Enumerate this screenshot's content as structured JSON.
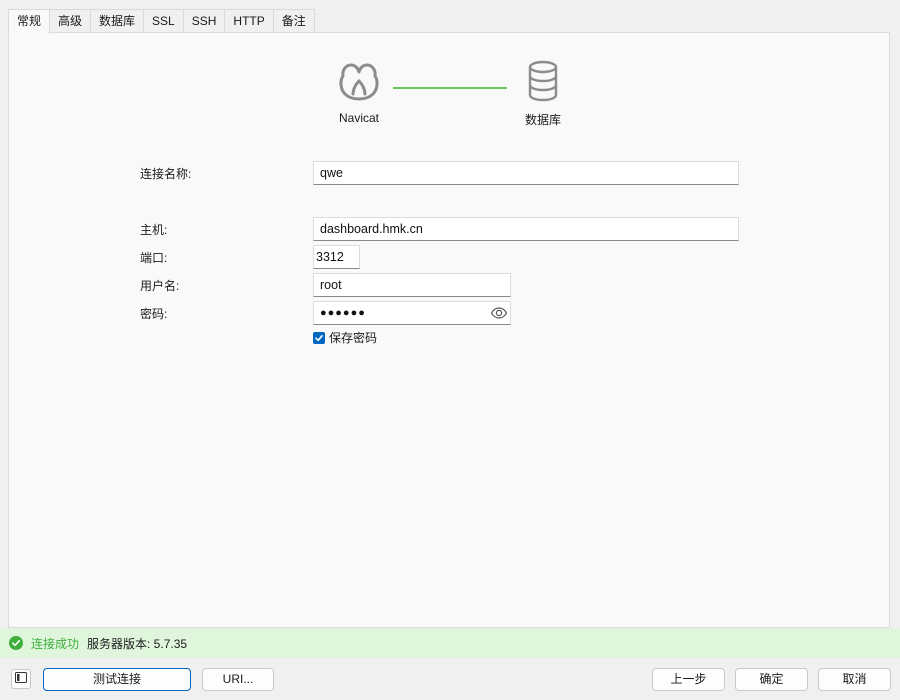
{
  "tabs": [
    {
      "label": "常规",
      "active": true
    },
    {
      "label": "高级"
    },
    {
      "label": "数据库"
    },
    {
      "label": "SSL"
    },
    {
      "label": "SSH"
    },
    {
      "label": "HTTP"
    },
    {
      "label": "备注"
    }
  ],
  "diagram": {
    "source_label": "Navicat",
    "source_icon": "navicat-logo-icon",
    "target_label": "数据库",
    "target_icon": "database-icon",
    "connector_color": "#63c957"
  },
  "form": {
    "connection_name_label": "连接名称:",
    "connection_name_value": "qwe",
    "host_label": "主机:",
    "host_value": "dashboard.hmk.cn",
    "port_label": "端口:",
    "port_value": "3312",
    "username_label": "用户名:",
    "username_value": "root",
    "password_label": "密码:",
    "password_value": "●●●●●●",
    "save_password_label": "保存密码",
    "save_password_checked": true
  },
  "status": {
    "icon": "check-circle-icon",
    "message": "连接成功",
    "server_version": "服务器版本: 5.7.35",
    "color": "#3fae3c"
  },
  "buttons": {
    "test_connection": "测试连接",
    "uri": "URI...",
    "back": "上一步",
    "ok": "确定",
    "cancel": "取消"
  },
  "colors": {
    "accent": "#0067c0",
    "status_bg": "#dff6dd"
  }
}
